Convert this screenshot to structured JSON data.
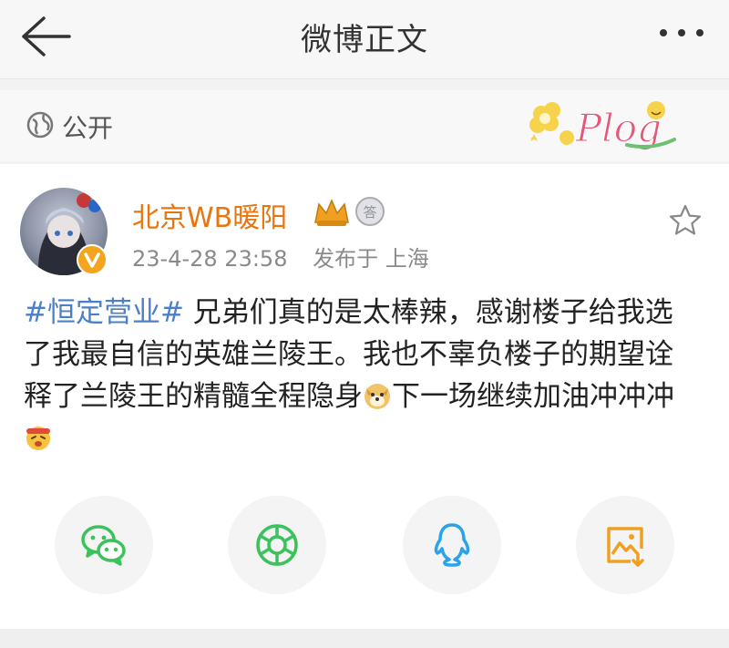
{
  "header": {
    "title": "微博正文",
    "back_icon": "arrow-left-icon",
    "more_icon": "more-dots-icon"
  },
  "visibility": {
    "label": "公开",
    "icon": "globe-icon",
    "sticker": "Plog"
  },
  "post": {
    "author": "北京WB暖阳",
    "date": "23-4-28 23:58",
    "location_text": "发布于 上海",
    "hashtag": "#恒定营业#",
    "text_1": " 兄弟们真的是太棒辣，感谢楼子给我选了我最自信的英雄兰陵王。我也不辜负楼子的期望诠释了兰陵王的精髓全程隐身",
    "text_2": "下一场继续加油冲冲冲",
    "emoji_1": "doge-emoji",
    "emoji_2": "fighting-emoji"
  },
  "share": {
    "items": [
      "wechat-icon",
      "moments-icon",
      "qq-icon",
      "save-image-icon"
    ]
  },
  "colors": {
    "username": "#e8750f",
    "hashtag": "#4b7fc7",
    "wechat": "#3cc25c",
    "moments": "#3cc25c",
    "qq": "#2aa3e8",
    "save": "#f0a020"
  }
}
